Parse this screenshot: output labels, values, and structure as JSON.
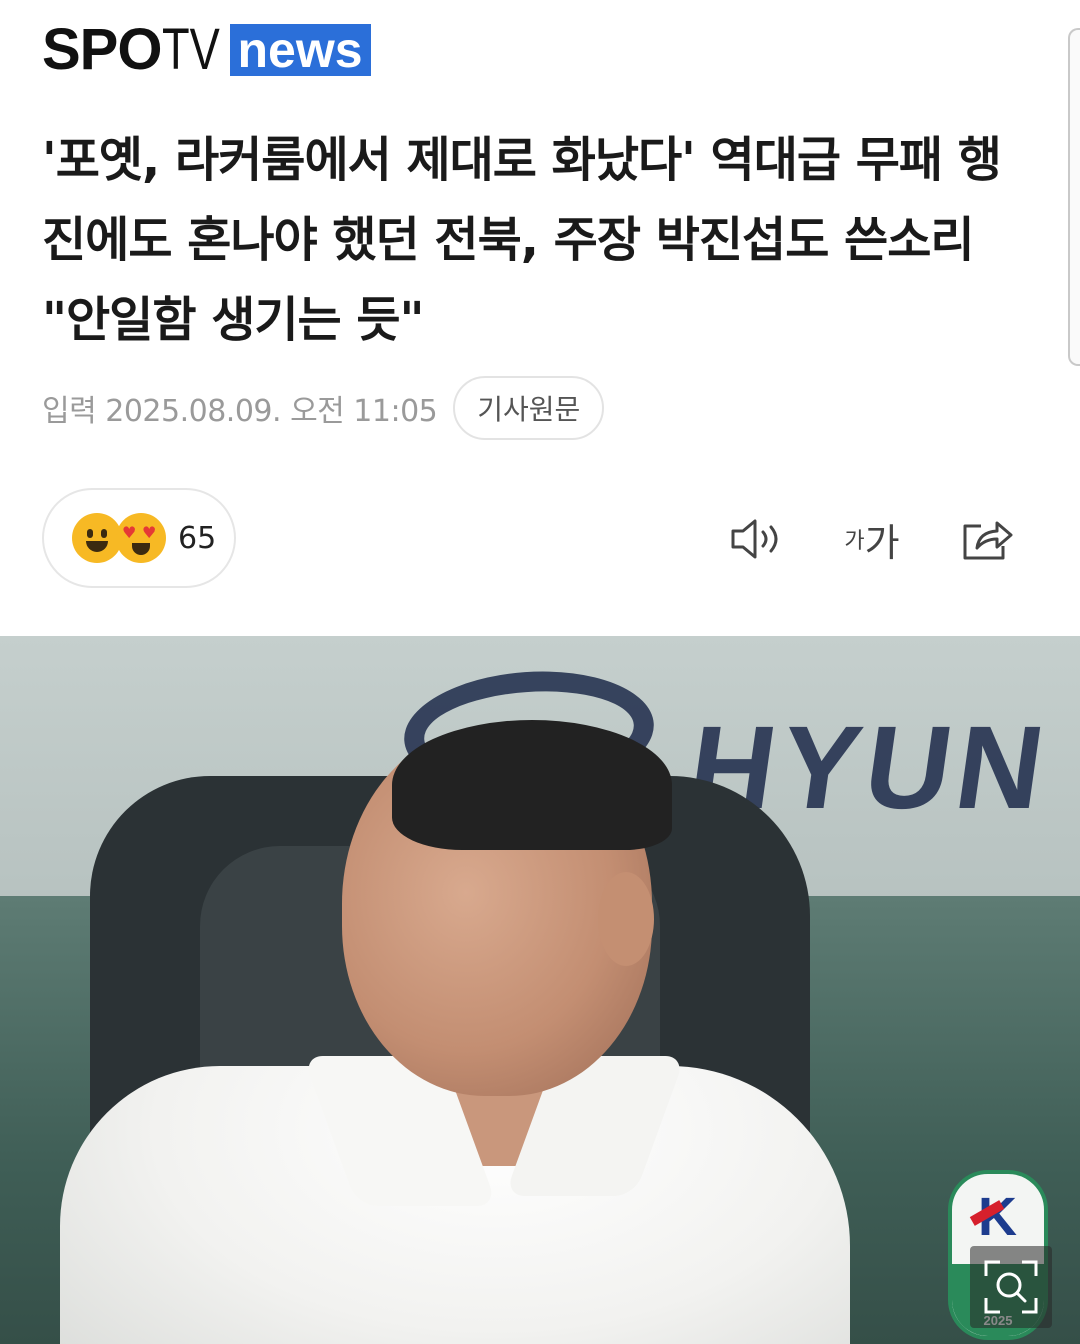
{
  "header": {
    "logo_spo": "SPO",
    "logo_tv": "TV",
    "logo_news": "news",
    "brand_color": "#2b6fd9"
  },
  "article": {
    "headline": "'포옛, 라커룸에서 제대로 화났다' 역대급 무패 행진에도 혼나야 했던 전북, 주장 박진섭도 쓴소리 \"안일함 생기는 듯\"",
    "date": "입력 2025.08.09. 오전 11:05",
    "original_button": "기사원문"
  },
  "reactions": {
    "count": "65",
    "icons": [
      "smile-emoji",
      "heart-eyes-emoji"
    ]
  },
  "toolbar": {
    "font_small": "가",
    "font_big": "가",
    "icons": [
      "speaker-icon",
      "font-size-icon",
      "share-icon"
    ]
  },
  "photo": {
    "billboard_text": "HYUN",
    "badge_year": "2025"
  }
}
